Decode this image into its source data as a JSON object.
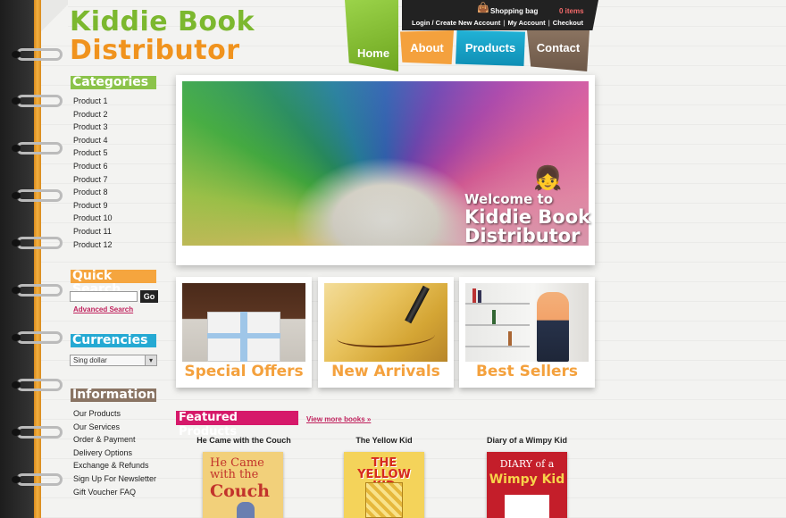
{
  "brand": {
    "line1": "Kiddie Book",
    "line2": "Distributor"
  },
  "topbar": {
    "bag_label": "Shopping bag",
    "items_count": "0 items",
    "links": [
      "Login / Create New Account",
      "My Account",
      "Checkout"
    ]
  },
  "nav": {
    "home": "Home",
    "about": "About",
    "products": "Products",
    "contact": "Contact"
  },
  "sidebar": {
    "categories_title": "Categories",
    "categories": [
      "Product 1",
      "Product 2",
      "Product 3",
      "Product 4",
      "Product 5",
      "Product 6",
      "Product 7",
      "Product 8",
      "Product 9",
      "Product 10",
      "Product 11",
      "Product 12"
    ],
    "quick_search_title": "Quick Search",
    "search_value": "",
    "go_label": "Go",
    "advanced_search": "Advanced Search",
    "currencies_title": "Currencies",
    "currency_selected": "Sing dollar",
    "information_title": "Information",
    "information": [
      "Our Products",
      "Our Services",
      "Order & Payment",
      "Delivery Options",
      "Exchange & Refunds",
      "Sign Up For Newsletter",
      "Gift Voucher FAQ"
    ]
  },
  "banner": {
    "welcome": "Welcome to",
    "line1": "Kiddie Book",
    "line2": "Distributor"
  },
  "features": [
    "Special Offers",
    "New Arrivals",
    "Best Sellers"
  ],
  "featured": {
    "title": "Featured Products",
    "view_more": "View more books »",
    "products": [
      {
        "title": "He Came with the Couch",
        "cover_line1": "He Came with the",
        "cover_line2": "Couch"
      },
      {
        "title": "The Yellow Kid",
        "cover_line1": "THE YELLOW KID"
      },
      {
        "title": "Diary of a Wimpy Kid",
        "cover_line1": "DIARY of a",
        "cover_line2": "Wimpy Kid"
      }
    ]
  },
  "colors": {
    "green": "#8bc34a",
    "orange": "#f5a53e",
    "blue": "#25a9d3",
    "brown": "#8a7463",
    "pink": "#d6196a"
  }
}
